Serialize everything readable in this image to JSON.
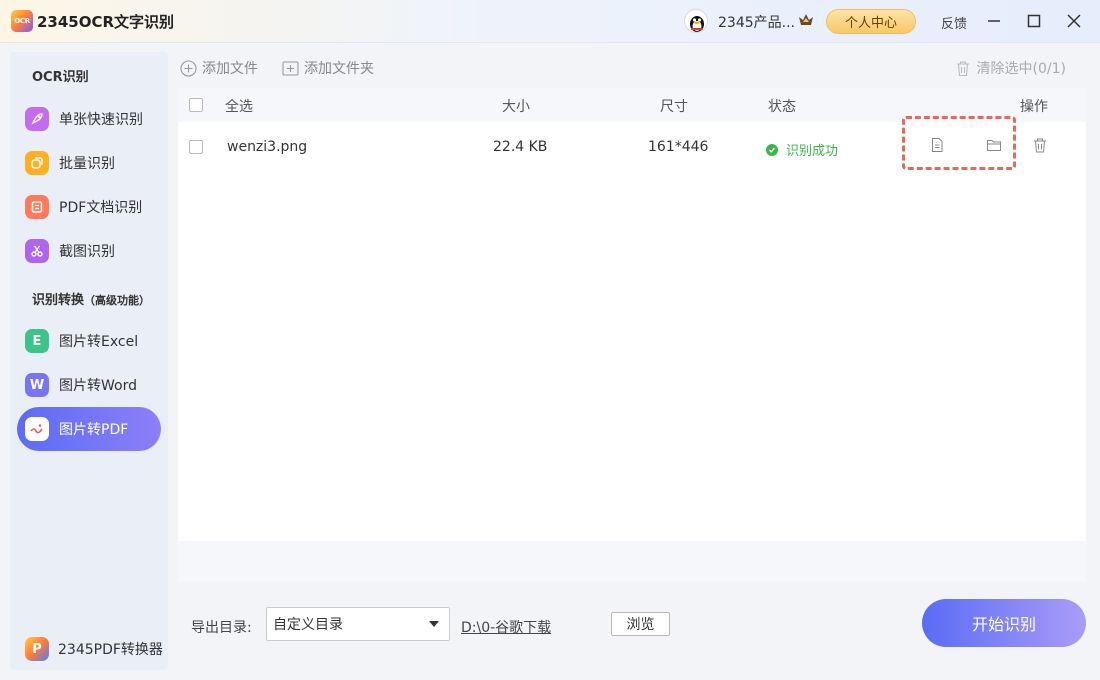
{
  "app": {
    "logo_text": "OCR",
    "title": "2345OCR文字识别",
    "user_name": "2345产品...",
    "personal_center": "个人中心",
    "feedback": "反馈"
  },
  "sidebar": {
    "section1": "OCR识别",
    "section2_main": "识别转换",
    "section2_sub": "（高级功能）",
    "items": [
      {
        "label": "单张快速识别",
        "icon": "rocket-icon",
        "color": "#c46bf0"
      },
      {
        "label": "批量识别",
        "icon": "batch-icon",
        "color": "#ffb020"
      },
      {
        "label": "PDF文档识别",
        "icon": "pdf-doc-icon",
        "color": "#ff7a5a"
      },
      {
        "label": "截图识别",
        "icon": "scissors-icon",
        "color": "#b165ee"
      },
      {
        "label": "图片转Excel",
        "icon": "excel-icon",
        "color": "#3cc48a",
        "glyph": "E"
      },
      {
        "label": "图片转Word",
        "icon": "word-icon",
        "color": "#7b74f2",
        "glyph": "W"
      },
      {
        "label": "图片转PDF",
        "icon": "image-pdf-icon",
        "color": "#ffffff",
        "active": true
      }
    ],
    "bottom_label": "2345PDF转换器",
    "bottom_logo_text": "P"
  },
  "toolbar": {
    "add_file": "添加文件",
    "add_folder": "添加文件夹",
    "clear_selected": "清除选中(0/1)"
  },
  "table": {
    "headers": {
      "select_all": "全选",
      "size": "大小",
      "dimensions": "尺寸",
      "status": "状态",
      "actions": "操作"
    },
    "rows": [
      {
        "name": "wenzi3.png",
        "size": "22.4 KB",
        "dimensions": "161*446",
        "status": "识别成功"
      }
    ]
  },
  "footer": {
    "export_label": "导出目录:",
    "export_option": "自定义目录",
    "export_path": "D:\\0-谷歌下载",
    "browse": "浏览",
    "start": "开始识别"
  }
}
